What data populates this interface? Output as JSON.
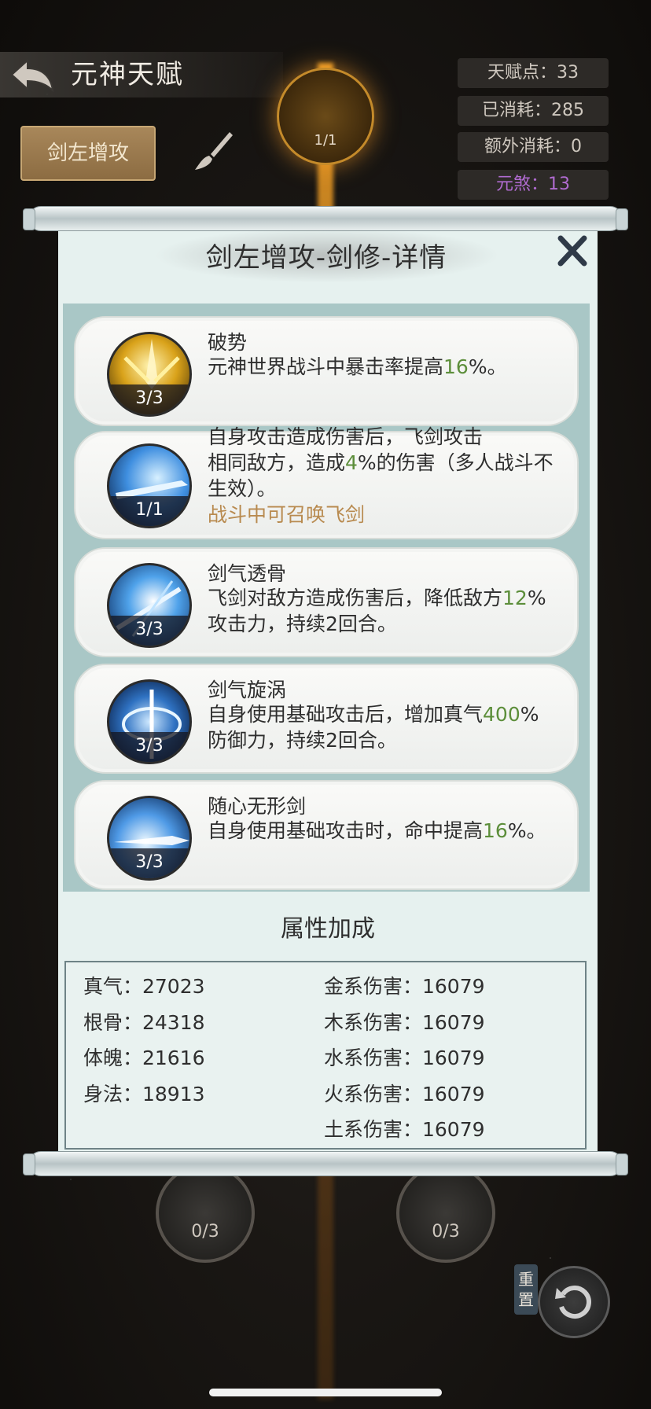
{
  "header": {
    "title": "元神天赋",
    "stats": {
      "talent_points": "天赋点：33",
      "consumed": "已消耗：285",
      "extra_consumed": "额外消耗：0",
      "yuansha": "元煞：13"
    },
    "tag_button": "剑左增攻"
  },
  "background": {
    "top_node_count": "1/1",
    "node_left_count": "0/3",
    "node_right_count": "0/3",
    "reset_label": "重置"
  },
  "dialog": {
    "title": "剑左增攻-剑修-详情",
    "talents": [
      {
        "name": "破势",
        "desc_before": "元神世界战斗中暴击率提高",
        "desc_value": "16",
        "desc_after": "%。",
        "count": "3/3",
        "icon": "golden-sword-burst-icon"
      },
      {
        "name": "自身攻击造成伤害后，飞剑攻击",
        "desc_before": "相同敌方，造成",
        "desc_value": "4",
        "desc_after": "%的伤害（多人战斗不生效）。",
        "extra": "战斗中可召唤飞剑",
        "count": "1/1",
        "icon": "flying-sword-icon"
      },
      {
        "name": "剑气透骨",
        "desc_before": "飞剑对敌方造成伤害后，降低敌方",
        "desc_value": "12",
        "desc_after": "%攻击力，持续2回合。",
        "count": "3/3",
        "icon": "sword-qi-pierce-icon"
      },
      {
        "name": "剑气旋涡",
        "desc_before": "自身使用基础攻击后，增加真气",
        "desc_value": "400",
        "desc_after": "%防御力，持续2回合。",
        "count": "3/3",
        "icon": "sword-vortex-icon"
      },
      {
        "name": "随心无形剑",
        "desc_before": "自身使用基础攻击时，命中提高",
        "desc_value": "16",
        "desc_after": "%。",
        "count": "3/3",
        "icon": "formless-sword-icon"
      }
    ],
    "attr_title": "属性加成",
    "attrs_left": [
      "真气：27023",
      "根骨：24318",
      "体魄：21616",
      "身法：18913"
    ],
    "attrs_right": [
      "金系伤害：16079",
      "木系伤害：16079",
      "水系伤害：16079",
      "火系伤害：16079",
      "土系伤害：16079"
    ]
  },
  "colors": {
    "accent_green": "#5c8e3a",
    "extra_text": "#b88a4f",
    "yuansha_purple": "#b06bd0"
  }
}
